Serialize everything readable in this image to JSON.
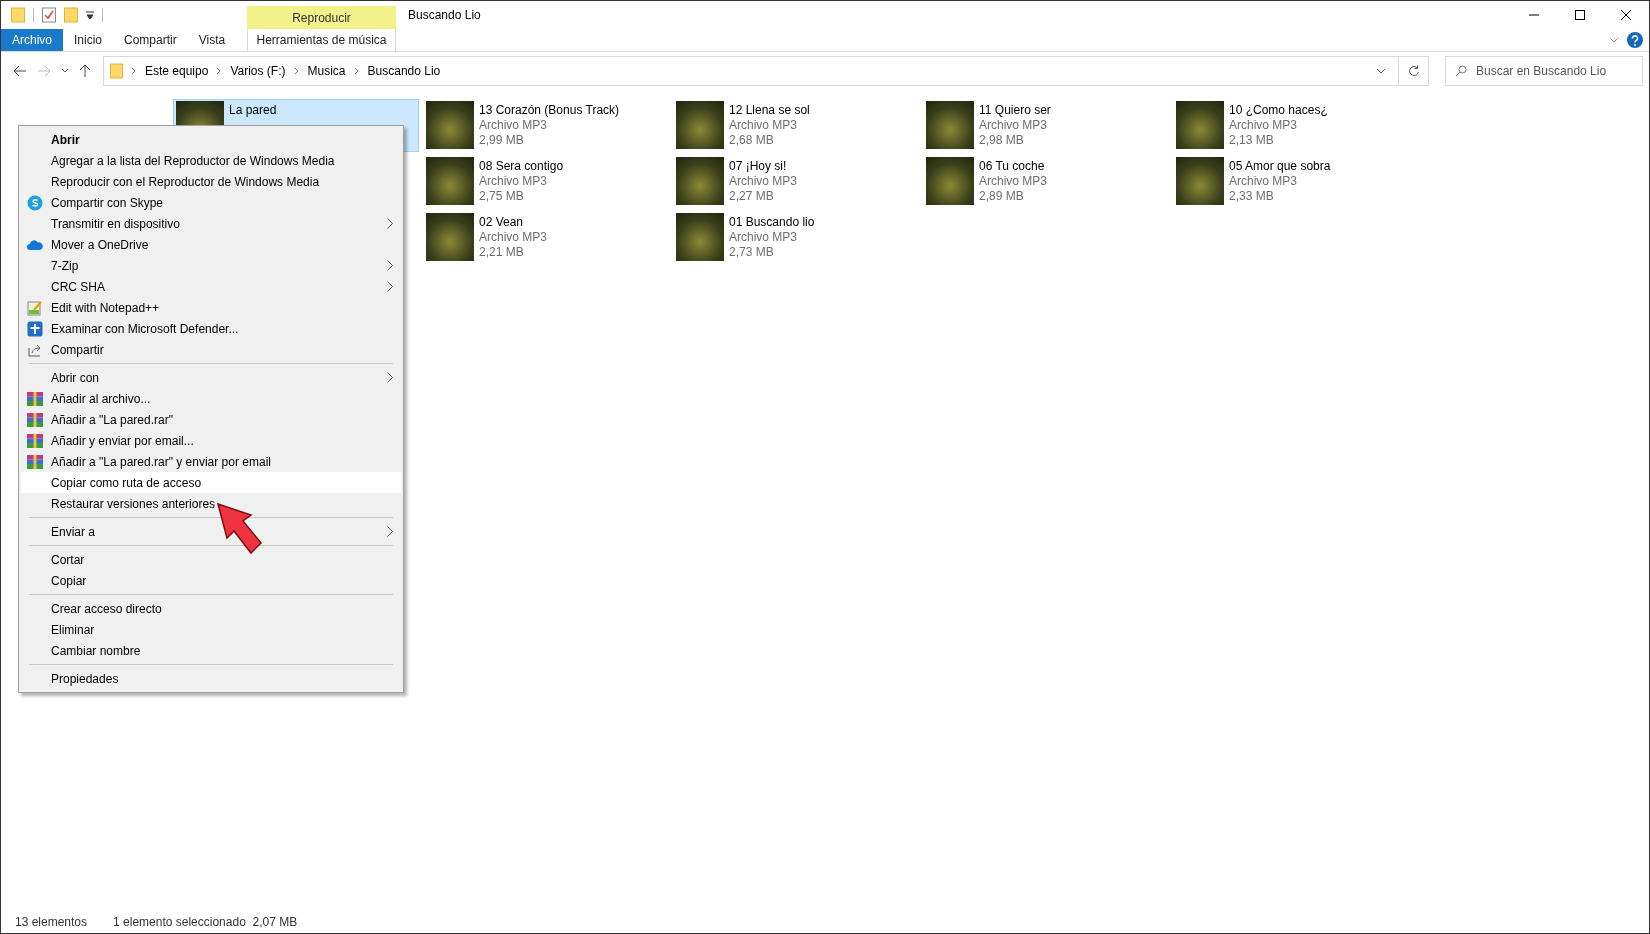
{
  "window": {
    "title": "Buscando Lio"
  },
  "ribbon": {
    "context_header": "Reproducir",
    "tabs": [
      {
        "label": "Archivo",
        "kind": "file",
        "selected": false
      },
      {
        "label": "Inicio",
        "kind": "tab",
        "selected": false
      },
      {
        "label": "Compartir",
        "kind": "tab",
        "selected": false
      },
      {
        "label": "Vista",
        "kind": "tab",
        "selected": false
      },
      {
        "label": "Herramientas de música",
        "kind": "context",
        "selected": false
      }
    ]
  },
  "address_bar": {
    "breadcrumbs": [
      "Este equipo",
      "Varios (F:)",
      "Musica",
      "Buscando Lio"
    ]
  },
  "search": {
    "placeholder": "Buscar en Buscando Lio"
  },
  "file_rows": [
    {
      "files": [
        {
          "name": "La pared",
          "selected": true
        },
        {
          "name": "13 Corazón (Bonus Track)",
          "type": "Archivo MP3",
          "size": "2,99 MB",
          "selected": false
        },
        {
          "name": "12 Llena se sol",
          "type": "Archivo MP3",
          "size": "2,68 MB",
          "selected": false
        },
        {
          "name": "11 Quiero ser",
          "type": "Archivo MP3",
          "size": "2,98 MB",
          "selected": false
        },
        {
          "name": "10 ¿Como haces¿",
          "type": "Archivo MP3",
          "size": "2,13 MB",
          "selected": false
        }
      ]
    },
    {
      "files": [
        {
          "name": "08 Sera contigo",
          "type": "Archivo MP3",
          "size": "2,75 MB",
          "selected": false
        },
        {
          "name": "07 ¡Hoy si!",
          "type": "Archivo MP3",
          "size": "2,27 MB",
          "selected": false
        },
        {
          "name": "06 Tu coche",
          "type": "Archivo MP3",
          "size": "2,89 MB",
          "selected": false
        },
        {
          "name": "05 Amor que sobra",
          "type": "Archivo MP3",
          "size": "2,33 MB",
          "selected": false
        }
      ]
    },
    {
      "files": [
        {
          "name": "02 Vean",
          "type": "Archivo MP3",
          "size": "2,21 MB",
          "selected": false
        },
        {
          "name": "01 Buscando lio",
          "type": "Archivo MP3",
          "size": "2,73 MB",
          "selected": false
        }
      ]
    }
  ],
  "context_menu": [
    {
      "kind": "item",
      "label": "Abrir",
      "default": true,
      "submenu": false,
      "selected": false
    },
    {
      "kind": "item",
      "label": "Agregar a la lista del Reproductor de Windows Media",
      "default": false,
      "submenu": false,
      "selected": false
    },
    {
      "kind": "item",
      "label": "Reproducir con el Reproductor de Windows Media",
      "default": false,
      "submenu": false,
      "selected": false
    },
    {
      "kind": "item",
      "label": "Compartir con Skype",
      "default": false,
      "submenu": false,
      "selected": false
    },
    {
      "kind": "item",
      "label": "Transmitir en dispositivo",
      "default": false,
      "submenu": true,
      "selected": false
    },
    {
      "kind": "item",
      "label": "Mover a OneDrive",
      "default": false,
      "submenu": false,
      "selected": false
    },
    {
      "kind": "item",
      "label": "7-Zip",
      "default": false,
      "submenu": true,
      "selected": false
    },
    {
      "kind": "item",
      "label": "CRC SHA",
      "default": false,
      "submenu": true,
      "selected": false
    },
    {
      "kind": "item",
      "label": "Edit with Notepad++",
      "default": false,
      "submenu": false,
      "selected": false
    },
    {
      "kind": "item",
      "label": "Examinar con Microsoft Defender...",
      "default": false,
      "submenu": false,
      "selected": false
    },
    {
      "kind": "item",
      "label": "Compartir",
      "default": false,
      "submenu": false,
      "selected": false
    },
    {
      "kind": "separator"
    },
    {
      "kind": "item",
      "label": "Abrir con",
      "default": false,
      "submenu": true,
      "selected": false
    },
    {
      "kind": "item",
      "label": "Añadir al archivo...",
      "default": false,
      "submenu": false,
      "selected": false
    },
    {
      "kind": "item",
      "label": "Añadir a \"La pared.rar\"",
      "default": false,
      "submenu": false,
      "selected": false
    },
    {
      "kind": "item",
      "label": "Añadir y enviar por email...",
      "default": false,
      "submenu": false,
      "selected": false
    },
    {
      "kind": "item",
      "label": "Añadir a \"La pared.rar\" y enviar por email",
      "default": false,
      "submenu": false,
      "selected": false
    },
    {
      "kind": "item",
      "label": "Copiar como ruta de acceso",
      "default": false,
      "submenu": false,
      "selected": true
    },
    {
      "kind": "item",
      "label": "Restaurar versiones anteriores",
      "default": false,
      "submenu": false,
      "selected": false
    },
    {
      "kind": "separator"
    },
    {
      "kind": "item",
      "label": "Enviar a",
      "default": false,
      "submenu": true,
      "selected": false
    },
    {
      "kind": "separator"
    },
    {
      "kind": "item",
      "label": "Cortar",
      "default": false,
      "submenu": false,
      "selected": false
    },
    {
      "kind": "item",
      "label": "Copiar",
      "default": false,
      "submenu": false,
      "selected": false
    },
    {
      "kind": "separator"
    },
    {
      "kind": "item",
      "label": "Crear acceso directo",
      "default": false,
      "submenu": false,
      "selected": false
    },
    {
      "kind": "item",
      "label": "Eliminar",
      "default": false,
      "submenu": false,
      "selected": false
    },
    {
      "kind": "item",
      "label": "Cambiar nombre",
      "default": false,
      "submenu": false,
      "selected": false
    },
    {
      "kind": "separator"
    },
    {
      "kind": "item",
      "label": "Propiedades",
      "default": false,
      "submenu": false,
      "selected": false
    }
  ],
  "status_bar": {
    "count": "13 elementos",
    "selection": "1 elemento seleccionado  2,07 MB"
  }
}
